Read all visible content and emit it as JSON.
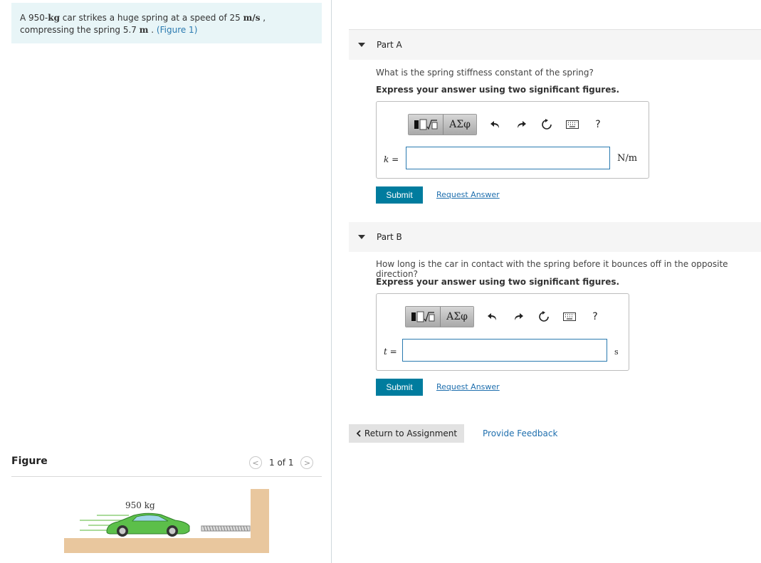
{
  "problem": {
    "text_1": "A 950-",
    "mass_unit": "kg",
    "text_2": " car strikes a huge spring at a speed of 25 ",
    "speed_unit": "m/s",
    "text_3": " , compressing the spring 5.7 ",
    "len_unit": "m",
    "text_4": " . ",
    "figure_link": "(Figure 1)"
  },
  "figure_panel": {
    "title": "Figure",
    "pager_prev": "<",
    "pager_text": "1 of 1",
    "pager_next": ">",
    "car_label": "950 kg"
  },
  "toolbar": {
    "greek_label": "ΑΣφ",
    "help_label": "?",
    "icons": [
      "templates-icon",
      "greek-symbols-icon",
      "undo-icon",
      "redo-icon",
      "reset-icon",
      "keyboard-icon",
      "help-icon"
    ]
  },
  "part_a": {
    "label": "Part A",
    "question": "What is the spring stiffness constant of the spring?",
    "instruction": "Express your answer using two significant figures.",
    "variable": "k",
    "equals": "=",
    "value": "",
    "unit": "N/m",
    "submit": "Submit",
    "request": "Request Answer"
  },
  "part_b": {
    "label": "Part B",
    "question": "How long is the car in contact with the spring before it bounces off in the opposite direction?",
    "instruction": "Express your answer using two significant figures.",
    "variable": "t",
    "equals": "=",
    "value": "",
    "unit": "s",
    "submit": "Submit",
    "request": "Request Answer"
  },
  "footer": {
    "return": "Return to Assignment",
    "feedback": "Provide Feedback"
  },
  "colors": {
    "accent": "#007c9e",
    "link": "#1f6fae",
    "problem_bg": "#e8f5f7"
  }
}
